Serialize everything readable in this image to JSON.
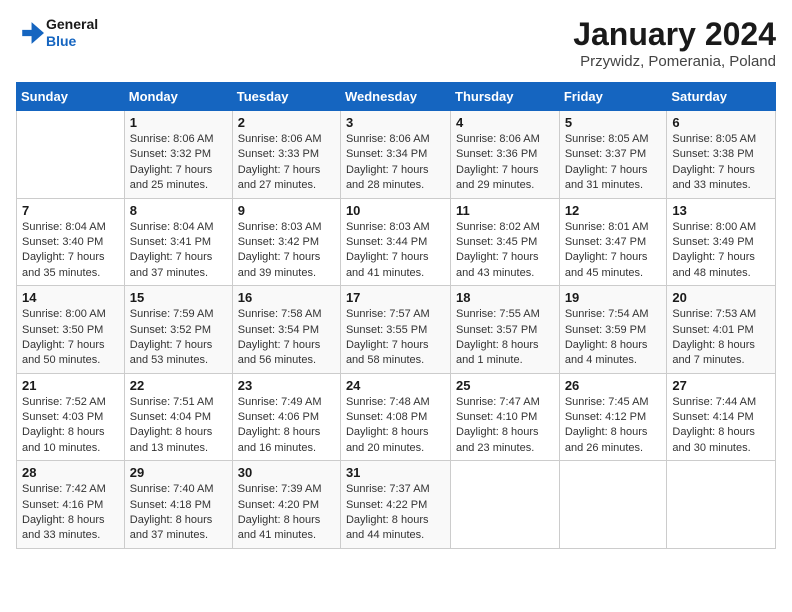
{
  "header": {
    "logo_line1": "General",
    "logo_line2": "Blue",
    "month": "January 2024",
    "location": "Przywidz, Pomerania, Poland"
  },
  "days_of_week": [
    "Sunday",
    "Monday",
    "Tuesday",
    "Wednesday",
    "Thursday",
    "Friday",
    "Saturday"
  ],
  "weeks": [
    [
      {
        "day": "",
        "detail": ""
      },
      {
        "day": "1",
        "detail": "Sunrise: 8:06 AM\nSunset: 3:32 PM\nDaylight: 7 hours\nand 25 minutes."
      },
      {
        "day": "2",
        "detail": "Sunrise: 8:06 AM\nSunset: 3:33 PM\nDaylight: 7 hours\nand 27 minutes."
      },
      {
        "day": "3",
        "detail": "Sunrise: 8:06 AM\nSunset: 3:34 PM\nDaylight: 7 hours\nand 28 minutes."
      },
      {
        "day": "4",
        "detail": "Sunrise: 8:06 AM\nSunset: 3:36 PM\nDaylight: 7 hours\nand 29 minutes."
      },
      {
        "day": "5",
        "detail": "Sunrise: 8:05 AM\nSunset: 3:37 PM\nDaylight: 7 hours\nand 31 minutes."
      },
      {
        "day": "6",
        "detail": "Sunrise: 8:05 AM\nSunset: 3:38 PM\nDaylight: 7 hours\nand 33 minutes."
      }
    ],
    [
      {
        "day": "7",
        "detail": ""
      },
      {
        "day": "8",
        "detail": "Sunrise: 8:04 AM\nSunset: 3:41 PM\nDaylight: 7 hours\nand 37 minutes."
      },
      {
        "day": "9",
        "detail": "Sunrise: 8:03 AM\nSunset: 3:42 PM\nDaylight: 7 hours\nand 39 minutes."
      },
      {
        "day": "10",
        "detail": "Sunrise: 8:03 AM\nSunset: 3:44 PM\nDaylight: 7 hours\nand 41 minutes."
      },
      {
        "day": "11",
        "detail": "Sunrise: 8:02 AM\nSunset: 3:45 PM\nDaylight: 7 hours\nand 43 minutes."
      },
      {
        "day": "12",
        "detail": "Sunrise: 8:01 AM\nSunset: 3:47 PM\nDaylight: 7 hours\nand 45 minutes."
      },
      {
        "day": "13",
        "detail": "Sunrise: 8:00 AM\nSunset: 3:49 PM\nDaylight: 7 hours\nand 48 minutes."
      }
    ],
    [
      {
        "day": "14",
        "detail": "Sunrise: 8:00 AM\nSunset: 3:50 PM\nDaylight: 7 hours\nand 50 minutes."
      },
      {
        "day": "15",
        "detail": "Sunrise: 7:59 AM\nSunset: 3:52 PM\nDaylight: 7 hours\nand 53 minutes."
      },
      {
        "day": "16",
        "detail": "Sunrise: 7:58 AM\nSunset: 3:54 PM\nDaylight: 7 hours\nand 56 minutes."
      },
      {
        "day": "17",
        "detail": "Sunrise: 7:57 AM\nSunset: 3:55 PM\nDaylight: 7 hours\nand 58 minutes."
      },
      {
        "day": "18",
        "detail": "Sunrise: 7:55 AM\nSunset: 3:57 PM\nDaylight: 8 hours\nand 1 minute."
      },
      {
        "day": "19",
        "detail": "Sunrise: 7:54 AM\nSunset: 3:59 PM\nDaylight: 8 hours\nand 4 minutes."
      },
      {
        "day": "20",
        "detail": "Sunrise: 7:53 AM\nSunset: 4:01 PM\nDaylight: 8 hours\nand 7 minutes."
      }
    ],
    [
      {
        "day": "21",
        "detail": "Sunrise: 7:52 AM\nSunset: 4:03 PM\nDaylight: 8 hours\nand 10 minutes."
      },
      {
        "day": "22",
        "detail": "Sunrise: 7:51 AM\nSunset: 4:04 PM\nDaylight: 8 hours\nand 13 minutes."
      },
      {
        "day": "23",
        "detail": "Sunrise: 7:49 AM\nSunset: 4:06 PM\nDaylight: 8 hours\nand 16 minutes."
      },
      {
        "day": "24",
        "detail": "Sunrise: 7:48 AM\nSunset: 4:08 PM\nDaylight: 8 hours\nand 20 minutes."
      },
      {
        "day": "25",
        "detail": "Sunrise: 7:47 AM\nSunset: 4:10 PM\nDaylight: 8 hours\nand 23 minutes."
      },
      {
        "day": "26",
        "detail": "Sunrise: 7:45 AM\nSunset: 4:12 PM\nDaylight: 8 hours\nand 26 minutes."
      },
      {
        "day": "27",
        "detail": "Sunrise: 7:44 AM\nSunset: 4:14 PM\nDaylight: 8 hours\nand 30 minutes."
      }
    ],
    [
      {
        "day": "28",
        "detail": "Sunrise: 7:42 AM\nSunset: 4:16 PM\nDaylight: 8 hours\nand 33 minutes."
      },
      {
        "day": "29",
        "detail": "Sunrise: 7:40 AM\nSunset: 4:18 PM\nDaylight: 8 hours\nand 37 minutes."
      },
      {
        "day": "30",
        "detail": "Sunrise: 7:39 AM\nSunset: 4:20 PM\nDaylight: 8 hours\nand 41 minutes."
      },
      {
        "day": "31",
        "detail": "Sunrise: 7:37 AM\nSunset: 4:22 PM\nDaylight: 8 hours\nand 44 minutes."
      },
      {
        "day": "",
        "detail": ""
      },
      {
        "day": "",
        "detail": ""
      },
      {
        "day": "",
        "detail": ""
      }
    ]
  ],
  "week7_sunday": {
    "day": "7",
    "detail": "Sunrise: 8:04 AM\nSunset: 3:40 PM\nDaylight: 7 hours\nand 35 minutes."
  }
}
